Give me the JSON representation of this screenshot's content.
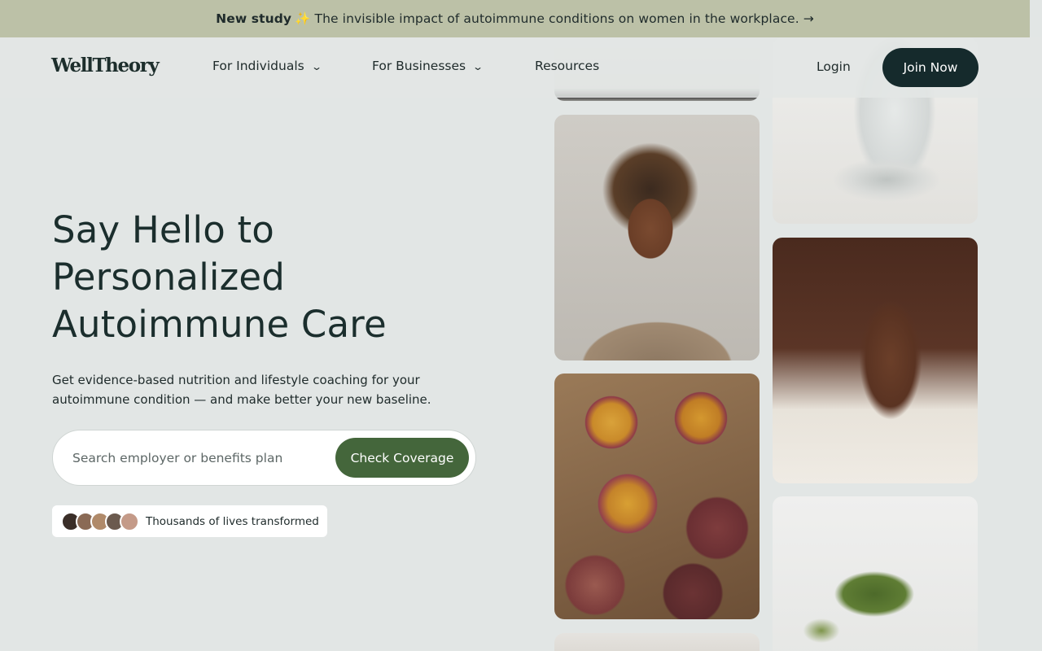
{
  "banner": {
    "bold": "New study",
    "sparkle": "✨",
    "text": "The invisible impact of autoimmune conditions on women in the workplace. →"
  },
  "nav": {
    "logo": "WellTheory",
    "items": [
      {
        "label": "For Individuals",
        "chevron": "⌄"
      },
      {
        "label": "For Businesses",
        "chevron": "⌄"
      },
      {
        "label": "Resources"
      }
    ],
    "login": "Login",
    "join": "Join Now"
  },
  "hero": {
    "title_lines": [
      "Say Hello to",
      "Personalized",
      "Autoimmune Care"
    ],
    "subtitle": "Get evidence-based nutrition and lifestyle coaching for your autoimmune condition — and make better your new baseline."
  },
  "search": {
    "placeholder": "Search employer or benefits plan",
    "value": "",
    "button": "Check Coverage"
  },
  "social_proof": {
    "text": "Thousands of lives transformed",
    "avatar_colors": [
      "#3a2e28",
      "#8a6a55",
      "#b08a6a",
      "#6b5a4e",
      "#c49a88"
    ]
  },
  "colors": {
    "banner_bg": "#bcc1a7",
    "page_bg": "#e2e6e5",
    "join_bg": "#152a2c",
    "cta_bg": "#44663b"
  }
}
